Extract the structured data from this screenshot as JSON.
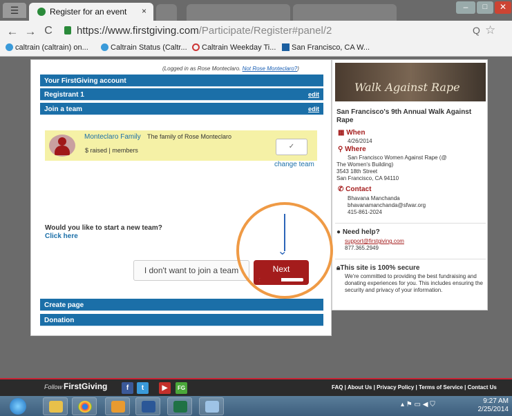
{
  "browser": {
    "tab_title": "Register for an event",
    "tab_close": "×",
    "url_main": "https://www.firstgiving.com",
    "url_path": "/Participate/Register#panel/2",
    "bookmarks": [
      "caltrain (caltrain) on...",
      "Caltrain Status (Caltr...",
      "Caltrain Weekday Ti...",
      "San Francisco, CA W..."
    ]
  },
  "form": {
    "logged_in_prefix": "(Logged in as Rose Monteclaro.",
    "not_user_link": "Not Rose Monteclaro?",
    "logged_in_suffix": ")",
    "sections": {
      "account": "Your FirstGiving account",
      "registrant": "Registrant 1",
      "join_team": "Join a team",
      "create_page": "Create page",
      "donation": "Donation"
    },
    "edit_label": "edit",
    "team": {
      "name": "Monteclaro Family",
      "description": "The family of Rose Monteclaro",
      "raised": "$ raised | members",
      "check": "✓"
    },
    "change_team": "change team",
    "new_team_question": "Would you like to start a new team?",
    "click_here": "Click here",
    "no_join_button": "I don't want to join a team",
    "next_button": "Next",
    "progress_fraction": 0.5
  },
  "event": {
    "banner_text": "Walk Against Rape",
    "title": "San Francisco's 9th Annual Walk Against Rape",
    "when_label": "When",
    "when_value": "4/26/2014",
    "where_label": "Where",
    "where_lines": [
      "San Francisco Women Against Rape (@",
      "The Women's Building)",
      "3543 18th Street",
      "San Francisco, CA 94110"
    ],
    "contact_label": "Contact",
    "contact_lines": [
      "Bhavana Manchanda",
      "bhavanamanchanda@sfwar.org",
      "415-861-2024"
    ],
    "help_label": "Need help?",
    "help_email": "support@firstgiving.com",
    "help_phone": "877.365.2949",
    "secure_label": "This site is 100% secure",
    "secure_text": "We're committed to providing the best fundraising and donating experiences for you. This includes ensuring the security and privacy of your information."
  },
  "footer": {
    "follow": "Follow",
    "brand": "FirstGiving",
    "links": "FAQ | About Us | Privacy Policy | Terms of Service | Contact Us"
  },
  "taskbar": {
    "time": "9:27 AM",
    "date": "2/25/2014"
  },
  "colors": {
    "section_blue": "#1b6fa8",
    "brand_red": "#a41c1c",
    "annotation_orange": "#ef9a45",
    "annotation_arrow": "#2a64b8"
  }
}
